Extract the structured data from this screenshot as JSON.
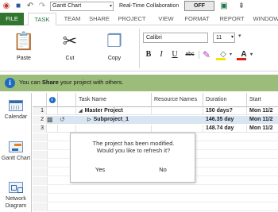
{
  "quick_access": {
    "view_selector": "Gantt Chart",
    "realtime_label": "Real-Time Collaboration",
    "realtime_state": "OFF",
    "icons": [
      "app-icon",
      "save-icon",
      "undo-icon",
      "redo-icon",
      "collaboration-icon",
      "more-icon"
    ]
  },
  "tabs": [
    {
      "label": "FILE"
    },
    {
      "label": "TASK"
    },
    {
      "label": "TEAM"
    },
    {
      "label": "SHARE"
    },
    {
      "label": "PROJECT"
    },
    {
      "label": "VIEW"
    },
    {
      "label": "FORMAT"
    },
    {
      "label": "REPORT"
    },
    {
      "label": "WINDOW"
    }
  ],
  "active_tab": "TASK",
  "ribbon": {
    "paste_label": "Paste",
    "cut_label": "Cut",
    "copy_label": "Copy",
    "font_name": "Calibri",
    "font_size": "11",
    "bold_label": "B",
    "italic_label": "I",
    "underline_label": "U",
    "strike_label": "abc",
    "font_color_label": "A"
  },
  "share_bar": {
    "text_before": "You can ",
    "text_bold": "Share",
    "text_after": " your project with others."
  },
  "view_bar": [
    {
      "label": "Calendar"
    },
    {
      "label": "Gantt Chart"
    },
    {
      "label": "Network Diagram"
    }
  ],
  "grid": {
    "headers": {
      "task_name": "Task Name",
      "resource_names": "Resource Names",
      "duration": "Duration",
      "start": "Start"
    },
    "rows": [
      {
        "id": "1",
        "name": "Master Project",
        "duration": "150 days?",
        "start": "Mon 11/2"
      },
      {
        "id": "2",
        "name": "Subproject_1",
        "duration": "146.35 day",
        "start": "Mon 11/2"
      },
      {
        "id": "3",
        "name": "",
        "duration": "148.74 day",
        "start": "Mon 11/2"
      }
    ]
  },
  "dialog": {
    "message_line1": "The project has been modified.",
    "message_line2": "Would you like to refresh it?",
    "yes_label": "Yes",
    "no_label": "No"
  },
  "colors": {
    "file_tab": "#31752f",
    "share_bar": "#9cbc7a",
    "info_icon": "#1f6bc3",
    "selected_row": "#d7e6f5"
  }
}
